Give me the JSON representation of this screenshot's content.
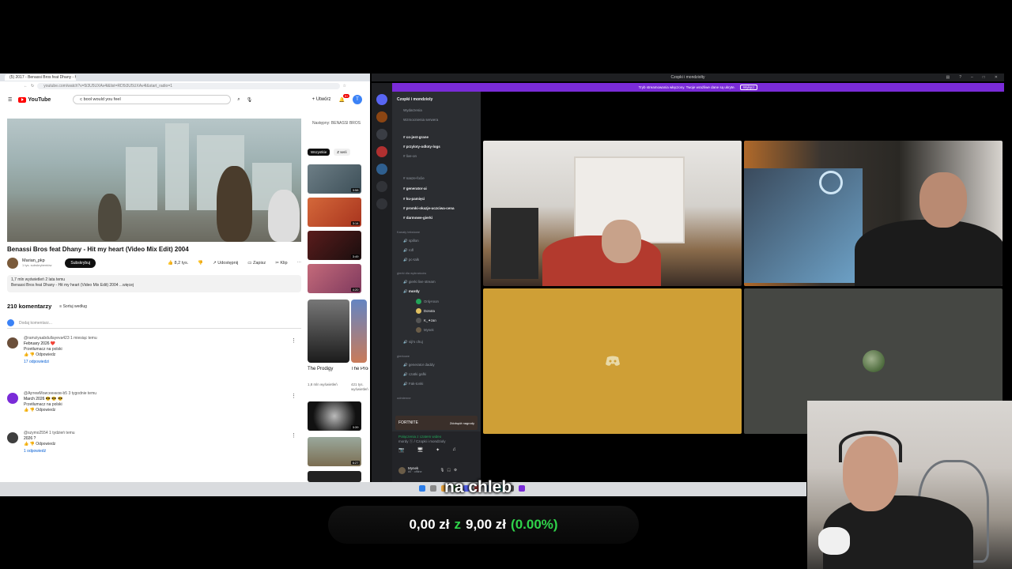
{
  "browser": {
    "tab_label": "(5) 2017 - Benassi Bros feat Dhany - Hit my heart...",
    "url": "youtube.com/watch?v=5i3U5UXAv4l&list=RD5i3U5UXAv4l&start_radio=1",
    "bottom_note": "youtube.com"
  },
  "youtube": {
    "logo_text": "YouTube",
    "search_value": "c bool would you feel",
    "create_label": "Utwórz",
    "notif_count": "9+",
    "avatar_letter": "T",
    "video_title": "Benassi Bros feat Dhany - Hit my heart (Video Mix Edit) 2004",
    "channel_name": "Marian_pkp",
    "channel_subs": "1 tys. subskrybentów",
    "subscribe_label": "Subskrybuj",
    "like_count": "8,2 tys.",
    "share_label": "Udostępnij",
    "save_label": "Zapisz",
    "clip_label": "Klip",
    "desc_line1": "1,7 mln wyświetleń  2 lata temu",
    "desc_line2": "Benassi Bros feat Dhany - Hit my heart (Video Mix Edit) 2004 ...więcej",
    "comments_count": "210 komentarzy",
    "sort_label": "Sortuj według",
    "add_comment_placeholder": "Dodaj komentarz...",
    "next_label": "Następny: BENASSI BROS",
    "chip_all": "Wszystkie",
    "chip_other": "Z serii",
    "comments": [
      {
        "author": "@ramziyaabdullayeva423  1 miesiąc temu",
        "text": "February 2026 ❤️",
        "sub": "Przetłumacz na polski",
        "reply": "Odpowiedz",
        "replies": "17 odpowiedzi"
      },
      {
        "author": "@АртемМоисеенков-b5  3 tygodnie temu",
        "text": "March 2026 😎 😎 😎",
        "sub": "Przetłumacz na polski",
        "reply": "Odpowiedz",
        "replies": ""
      },
      {
        "author": "@szymo2554  1 tydzień temu",
        "text": "2026 ?",
        "sub": "",
        "reply": "Odpowiedz",
        "replies": "1 odpowiedź"
      }
    ],
    "thumb_durations": [
      "3:58",
      "3:14",
      "3:49",
      "4:20",
      "3:39",
      "6:27"
    ],
    "short_1_title": "The Prodigy",
    "short_1_views": "1,8 mln wyświetleń",
    "short_2_title": "The Prodigy - Breathe",
    "short_2_views": "421 tys. wyświetleń"
  },
  "discord": {
    "window_title": "Czopki i mondziolty",
    "banner_text": "Tryb streamowania włączony. Twoje wrażliwe dane są ukryte.",
    "banner_button": "Wyłącz",
    "server_name": "Czopki i mondzioly",
    "top_items": [
      "Wydarzenia",
      "Wzmocnienia serwera"
    ],
    "channels": [
      "co-jest-grane",
      "przyloty-odloty-logs",
      "live-on",
      "nasze-foćie",
      "generator-ai",
      "ku-pamięci",
      "promki-okazje-uczciwa-cena",
      "darmowe-gierki"
    ],
    "category_voice": "Kanały tekstowe",
    "voice_channels": [
      "spillon",
      "rofl",
      "pc-talk",
      "gierki live stream",
      "mordy"
    ],
    "category_games": "gierki dla wybrańców",
    "voice_users": [
      "OnlyAnon",
      "Donota",
      "K_✦zan",
      "Mynek"
    ],
    "more_channels": [
      "siji's chuj",
      "generator daddy",
      "czatki gafki",
      "Fak-tonki"
    ],
    "category_more": "gierkowe",
    "category_last": "odmienne",
    "promo_label": "FORTNITE",
    "promo_button": "Zdobądź nagrody",
    "voice_status_1": "Połączenia z czatem wideo",
    "voice_status_2": "mordy ⓢ / Czopki i mondzioly",
    "me_name": "Mynek",
    "me_status": "#0 · offline"
  },
  "overlay": {
    "subtitle": "na chleb",
    "donation_current": "0,00 zł",
    "donation_sep": "z",
    "donation_goal": "9,00 zł",
    "donation_pct": "(0.00%)"
  },
  "colors": {
    "discord_purple": "#7a2bd8",
    "yt_red": "#ff0000",
    "donation_green": "#2fd34a",
    "tile_yellow": "#cf9f36",
    "tile_gray": "#454743"
  }
}
